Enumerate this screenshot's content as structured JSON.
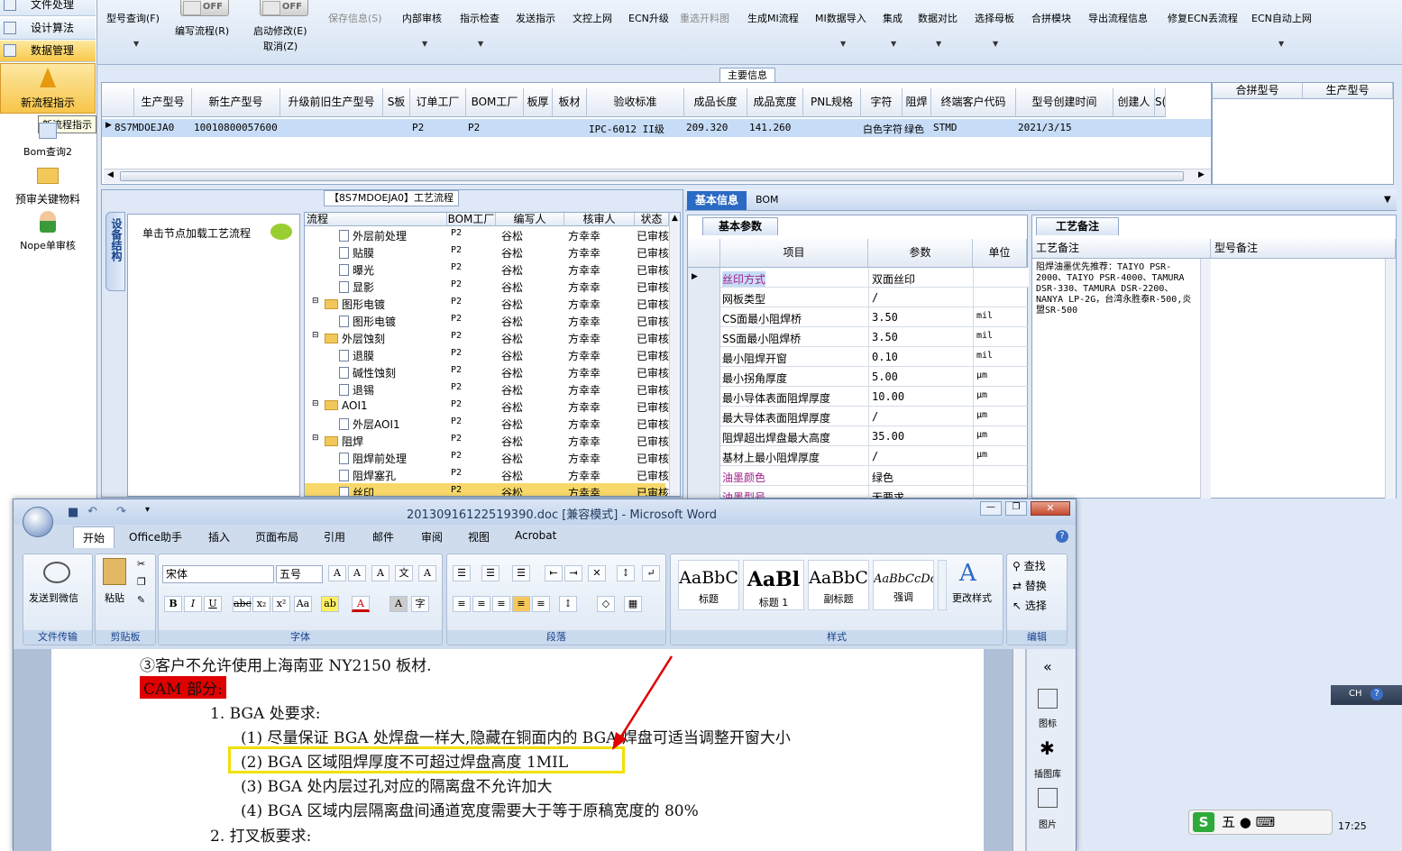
{
  "left_nav": {
    "items": [
      "文件处理",
      "设计算法",
      "数据管理"
    ],
    "new_flow": "新流程指示",
    "tooltip": "新流程指示",
    "bom_query": "Bom查询2",
    "prereview": "预审关键物料",
    "nope": "Nope单审核"
  },
  "toolbar": {
    "items": [
      "型号查询(F)",
      "保存信息(S)",
      "内部审核",
      "指示检查",
      "发送指示",
      "文控上网",
      "ECN升级",
      "重选开料图",
      "生成MI流程",
      "MI数据导入",
      "集成",
      "数据对比",
      "选择母板",
      "合拼模块",
      "导出流程信息",
      "修复ECN丢流程",
      "ECN自动上网"
    ],
    "toggle1_label": "编写流程(R)",
    "toggle2_label": "启动修改(E)",
    "toggle_state": "OFF",
    "cancel": "取消(Z)"
  },
  "main_info": {
    "title": "主要信息",
    "headers": [
      "生产型号",
      "新生产型号",
      "升级前旧生产型号",
      "S板",
      "订单工厂",
      "BOM工厂",
      "板厚",
      "板材",
      "验收标准",
      "成品长度",
      "成品宽度",
      "PNL规格",
      "字符",
      "阻焊",
      "终端客户代码",
      "型号创建时间",
      "创建人",
      "S("
    ],
    "row": [
      "8S7MDOEJA0",
      "10010800057600",
      "",
      "",
      "P2",
      "P2",
      "",
      "",
      "IPC-6012 II级",
      "209.320",
      "141.260",
      "",
      "白色字符",
      "绿色",
      "STMD",
      "2021/3/15",
      "",
      ""
    ],
    "side_headers": [
      "合拼型号",
      "生产型号"
    ]
  },
  "flow": {
    "title": "【8S7MDOEJA0】工艺流程",
    "vertical_tab": "设备结构",
    "hint": "单击节点加载工艺流程",
    "headers": [
      "流程",
      "BOM工厂",
      "编写人",
      "核审人",
      "状态"
    ],
    "rows": [
      {
        "name": "外层前处理",
        "type": "doc",
        "indent": 2,
        "bom": "P2",
        "writer": "谷松",
        "reviewer": "方幸幸",
        "status": "已审核"
      },
      {
        "name": "贴膜",
        "type": "doc",
        "indent": 2,
        "bom": "P2",
        "writer": "谷松",
        "reviewer": "方幸幸",
        "status": "已审核"
      },
      {
        "name": "曝光",
        "type": "doc",
        "indent": 2,
        "bom": "P2",
        "writer": "谷松",
        "reviewer": "方幸幸",
        "status": "已审核"
      },
      {
        "name": "显影",
        "type": "doc",
        "indent": 2,
        "bom": "P2",
        "writer": "谷松",
        "reviewer": "方幸幸",
        "status": "已审核"
      },
      {
        "name": "图形电镀",
        "type": "folder",
        "indent": 1,
        "bom": "P2",
        "writer": "谷松",
        "reviewer": "方幸幸",
        "status": "已审核"
      },
      {
        "name": "图形电镀",
        "type": "doc",
        "indent": 2,
        "bom": "P2",
        "writer": "谷松",
        "reviewer": "方幸幸",
        "status": "已审核"
      },
      {
        "name": "外层蚀刻",
        "type": "folder",
        "indent": 1,
        "bom": "P2",
        "writer": "谷松",
        "reviewer": "方幸幸",
        "status": "已审核"
      },
      {
        "name": "退膜",
        "type": "doc",
        "indent": 2,
        "bom": "P2",
        "writer": "谷松",
        "reviewer": "方幸幸",
        "status": "已审核"
      },
      {
        "name": "碱性蚀刻",
        "type": "doc",
        "indent": 2,
        "bom": "P2",
        "writer": "谷松",
        "reviewer": "方幸幸",
        "status": "已审核"
      },
      {
        "name": "退锡",
        "type": "doc",
        "indent": 2,
        "bom": "P2",
        "writer": "谷松",
        "reviewer": "方幸幸",
        "status": "已审核"
      },
      {
        "name": "AOI1",
        "type": "folder",
        "indent": 1,
        "bom": "P2",
        "writer": "谷松",
        "reviewer": "方幸幸",
        "status": "已审核"
      },
      {
        "name": "外层AOI1",
        "type": "doc",
        "indent": 2,
        "bom": "P2",
        "writer": "谷松",
        "reviewer": "方幸幸",
        "status": "已审核"
      },
      {
        "name": "阻焊",
        "type": "folder",
        "indent": 1,
        "bom": "P2",
        "writer": "谷松",
        "reviewer": "方幸幸",
        "status": "已审核"
      },
      {
        "name": "阻焊前处理",
        "type": "doc",
        "indent": 2,
        "bom": "P2",
        "writer": "谷松",
        "reviewer": "方幸幸",
        "status": "已审核"
      },
      {
        "name": "阻焊塞孔",
        "type": "doc",
        "indent": 2,
        "bom": "P2",
        "writer": "谷松",
        "reviewer": "方幸幸",
        "status": "已审核"
      },
      {
        "name": "丝印",
        "type": "doc",
        "indent": 2,
        "bom": "P2",
        "writer": "谷松",
        "reviewer": "方幸幸",
        "status": "已审核",
        "selected": true
      }
    ]
  },
  "basic": {
    "tab_basic": "基本信息",
    "tab_bom": "BOM",
    "subtab": "基本参数",
    "headers": [
      "项目",
      "参数",
      "单位"
    ],
    "rows": [
      {
        "item": "丝印方式",
        "value": "双面丝印",
        "unit": "",
        "hl": true
      },
      {
        "item": "网板类型",
        "value": "/",
        "unit": ""
      },
      {
        "item": "CS面最小阻焊桥",
        "value": "3.50",
        "unit": "mil"
      },
      {
        "item": "SS面最小阻焊桥",
        "value": "3.50",
        "unit": "mil"
      },
      {
        "item": "最小阻焊开窗",
        "value": "0.10",
        "unit": "mil"
      },
      {
        "item": "最小拐角厚度",
        "value": "5.00",
        "unit": "μm"
      },
      {
        "item": "最小导体表面阻焊厚度",
        "value": "10.00",
        "unit": "μm"
      },
      {
        "item": "最大导体表面阻焊厚度",
        "value": "/",
        "unit": "μm"
      },
      {
        "item": "阻焊超出焊盘最大高度",
        "value": "35.00",
        "unit": "μm"
      },
      {
        "item": "基材上最小阻焊厚度",
        "value": "/",
        "unit": "μm"
      },
      {
        "item": "油墨颜色",
        "value": "绿色",
        "unit": "",
        "hl": true
      },
      {
        "item": "油墨型号",
        "value": "无要求",
        "unit": "",
        "hl": true
      }
    ]
  },
  "remarks": {
    "tab": "工艺备注",
    "col1": "工艺备注",
    "col2": "型号备注",
    "text": "阻焊油墨优先推荐：TAIYO PSR-2000、TAIYO PSR-4000、TAMURA DSR-330、TAMURA DSR-2200、NANYA LP-2G，台湾永胜泰R-500,炎盟SR-500"
  },
  "word": {
    "title": "20130916122519390.doc [兼容模式] - Microsoft Word",
    "tabs": [
      "开始",
      "Office助手",
      "插入",
      "页面布局",
      "引用",
      "邮件",
      "审阅",
      "视图",
      "Acrobat"
    ],
    "groups": [
      "文件传输",
      "剪贴板",
      "字体",
      "段落",
      "样式",
      "编辑"
    ],
    "send_wechat": "发送到微信",
    "paste": "粘贴",
    "font_name": "宋体",
    "font_size": "五号",
    "styles": [
      {
        "sample": "AaBbC",
        "label": "标题"
      },
      {
        "sample": "AaBl",
        "label": "标题 1"
      },
      {
        "sample": "AaBbC",
        "label": "副标题"
      },
      {
        "sample": "AaBbCcDc",
        "label": "强调"
      }
    ],
    "change_style": "更改样式",
    "edit": [
      "查找",
      "替换",
      "选择"
    ],
    "side": [
      "图标",
      "插图库",
      "图片"
    ],
    "doc_lines": [
      "③客户不允许使用上海南亚 NY2150 板材.",
      "CAM 部分:",
      "1. BGA 处要求:",
      "(1) 尽量保证 BGA 处焊盘一样大,隐藏在铜面内的 BGA 焊盘可适当调整开窗大小",
      "(2) BGA 区域阻焊厚度不可超过焊盘高度 1MIL",
      "(3) BGA 处内层过孔对应的隔离盘不允许加大",
      "(4) BGA 区域内层隔离盘间通道宽度需要大于等于原稿宽度的 80%",
      "2. 打叉板要求:"
    ]
  },
  "tray": {
    "lang": "CH",
    "time": "17:25",
    "ime": "五"
  },
  "colors": {
    "accent": "#1f5fbf",
    "highlight_row": "#c7dcf6",
    "selected_tree": "#f8d86a",
    "red": "#e00000",
    "callout": "#f0e000"
  }
}
